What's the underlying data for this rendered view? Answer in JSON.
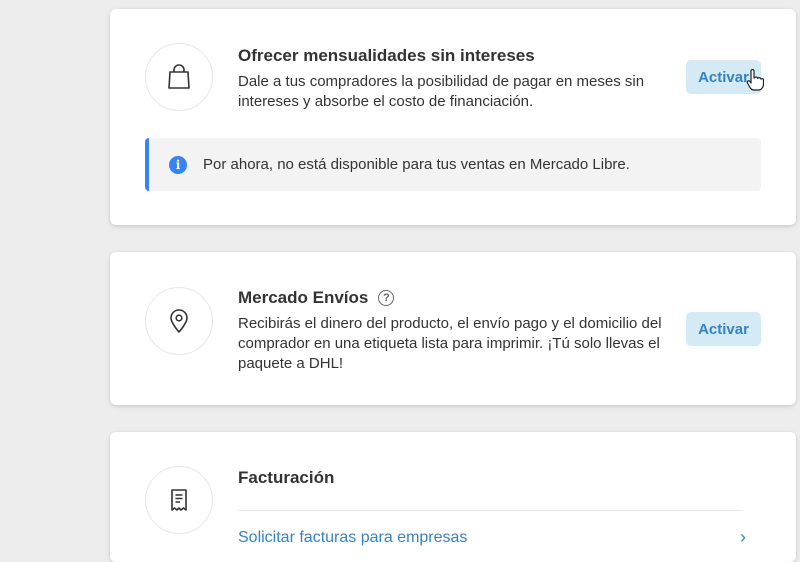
{
  "cards": {
    "installments": {
      "icon": "shopping-bag-icon",
      "title": "Ofrecer mensualidades sin intereses",
      "description_line1": "Dale a tus compradores la posibilidad de pagar en meses sin",
      "description_line2": "intereses y absorbe el costo de financiación.",
      "button_label": "Activar",
      "notice": {
        "icon": "info-icon",
        "text": "Por ahora, no está disponible para tus ventas en Mercado Libre."
      }
    },
    "shipping": {
      "icon": "location-pin-icon",
      "title": "Mercado Envíos",
      "help_icon": "question-circle-icon",
      "help_glyph": "?",
      "description_line1": "Recibirás el dinero del producto, el envío pago y el domicilio del",
      "description_line2": "comprador en una etiqueta lista para imprimir. ¡Tú solo llevas el",
      "description_line3": "paquete a DHL!",
      "button_label": "Activar"
    },
    "billing": {
      "icon": "receipt-icon",
      "title": "Facturación",
      "link_text": "Solicitar facturas para empresas",
      "chevron": "chevron-right-icon"
    }
  },
  "colors": {
    "accent": "#3483c5",
    "button_bg": "#d4eaf5",
    "info_blue": "#3483fa",
    "page_bg": "#ededed"
  }
}
